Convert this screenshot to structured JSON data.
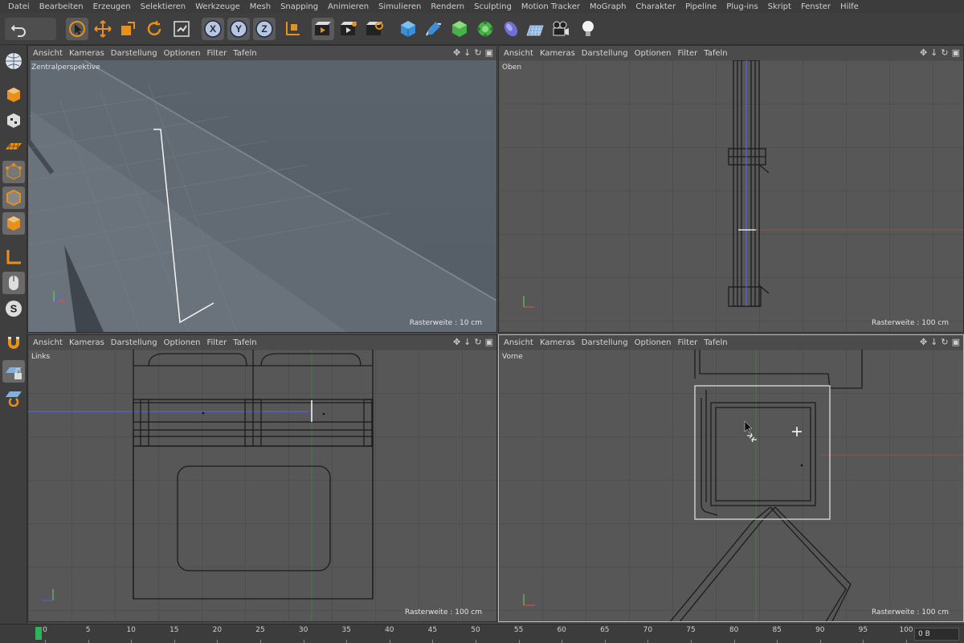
{
  "menubar": {
    "items": [
      "Datei",
      "Bearbeiten",
      "Erzeugen",
      "Selektieren",
      "Werkzeuge",
      "Mesh",
      "Snapping",
      "Animieren",
      "Simulieren",
      "Rendern",
      "Sculpting",
      "Motion Tracker",
      "MoGraph",
      "Charakter",
      "Pipeline",
      "Plug-ins",
      "Skript",
      "Fenster",
      "Hilfe"
    ]
  },
  "toolbar": {
    "undo_icon": "undo-icon",
    "tools": [
      {
        "name": "live-selection-icon",
        "selected": true
      },
      {
        "name": "move-icon",
        "selected": false
      },
      {
        "name": "scale-icon",
        "selected": false
      },
      {
        "name": "rotate-icon",
        "selected": false
      },
      {
        "name": "recent-tools-icon",
        "selected": false
      },
      {
        "name": "x-axis-lock-icon",
        "selected": true,
        "label": "X"
      },
      {
        "name": "y-axis-lock-icon",
        "selected": true,
        "label": "Y"
      },
      {
        "name": "z-axis-lock-icon",
        "selected": true,
        "label": "Z"
      },
      {
        "name": "coordinate-system-icon",
        "selected": false
      },
      {
        "name": "render-view-icon",
        "selected": false
      },
      {
        "name": "render-to-picture-viewer-icon",
        "selected": false
      },
      {
        "name": "render-settings-icon",
        "selected": false
      },
      {
        "name": "cube-icon",
        "selected": false
      },
      {
        "name": "pen-spline-icon",
        "selected": false
      },
      {
        "name": "subdivision-surface-icon",
        "selected": false
      },
      {
        "name": "cloner-icon",
        "selected": false
      },
      {
        "name": "deformer-icon",
        "selected": false
      },
      {
        "name": "floor-icon",
        "selected": false
      },
      {
        "name": "camera-icon",
        "selected": false
      },
      {
        "name": "light-icon",
        "selected": false
      }
    ]
  },
  "lefttools": [
    "globe-icon",
    "model-mode-icon",
    "texture-mode-icon",
    "workplane-icon",
    "points-mode-icon",
    "edges-mode-icon",
    "polygons-mode-icon",
    "axis-icon",
    "tweak-icon",
    "solo-icon",
    "magnet-icon",
    "lock-workplane-icon",
    "snapping-grid-icon"
  ],
  "viewport_menu": [
    "Ansicht",
    "Kameras",
    "Darstellung",
    "Optionen",
    "Filter",
    "Tafeln"
  ],
  "viewports": {
    "perspective": {
      "label": "Zentralperspektive",
      "raster": "Rasterweite : 10 cm"
    },
    "top": {
      "label": "Oben",
      "raster": "Rasterweite : 100 cm"
    },
    "left": {
      "label": "Links",
      "raster": "Rasterweite : 100 cm"
    },
    "front": {
      "label": "Vorne",
      "raster": "Rasterweite : 100 cm"
    }
  },
  "timeline": {
    "ticks": [
      "0",
      "5",
      "10",
      "15",
      "20",
      "25",
      "30",
      "35",
      "40",
      "45",
      "50",
      "55",
      "60",
      "65",
      "70",
      "75",
      "80",
      "85",
      "90",
      "95",
      "100"
    ],
    "current_frame": "0 B"
  },
  "colors": {
    "accent_orange": "#e8901c",
    "axis_blue": "#4b63c9",
    "playhead": "#2fb35a"
  }
}
